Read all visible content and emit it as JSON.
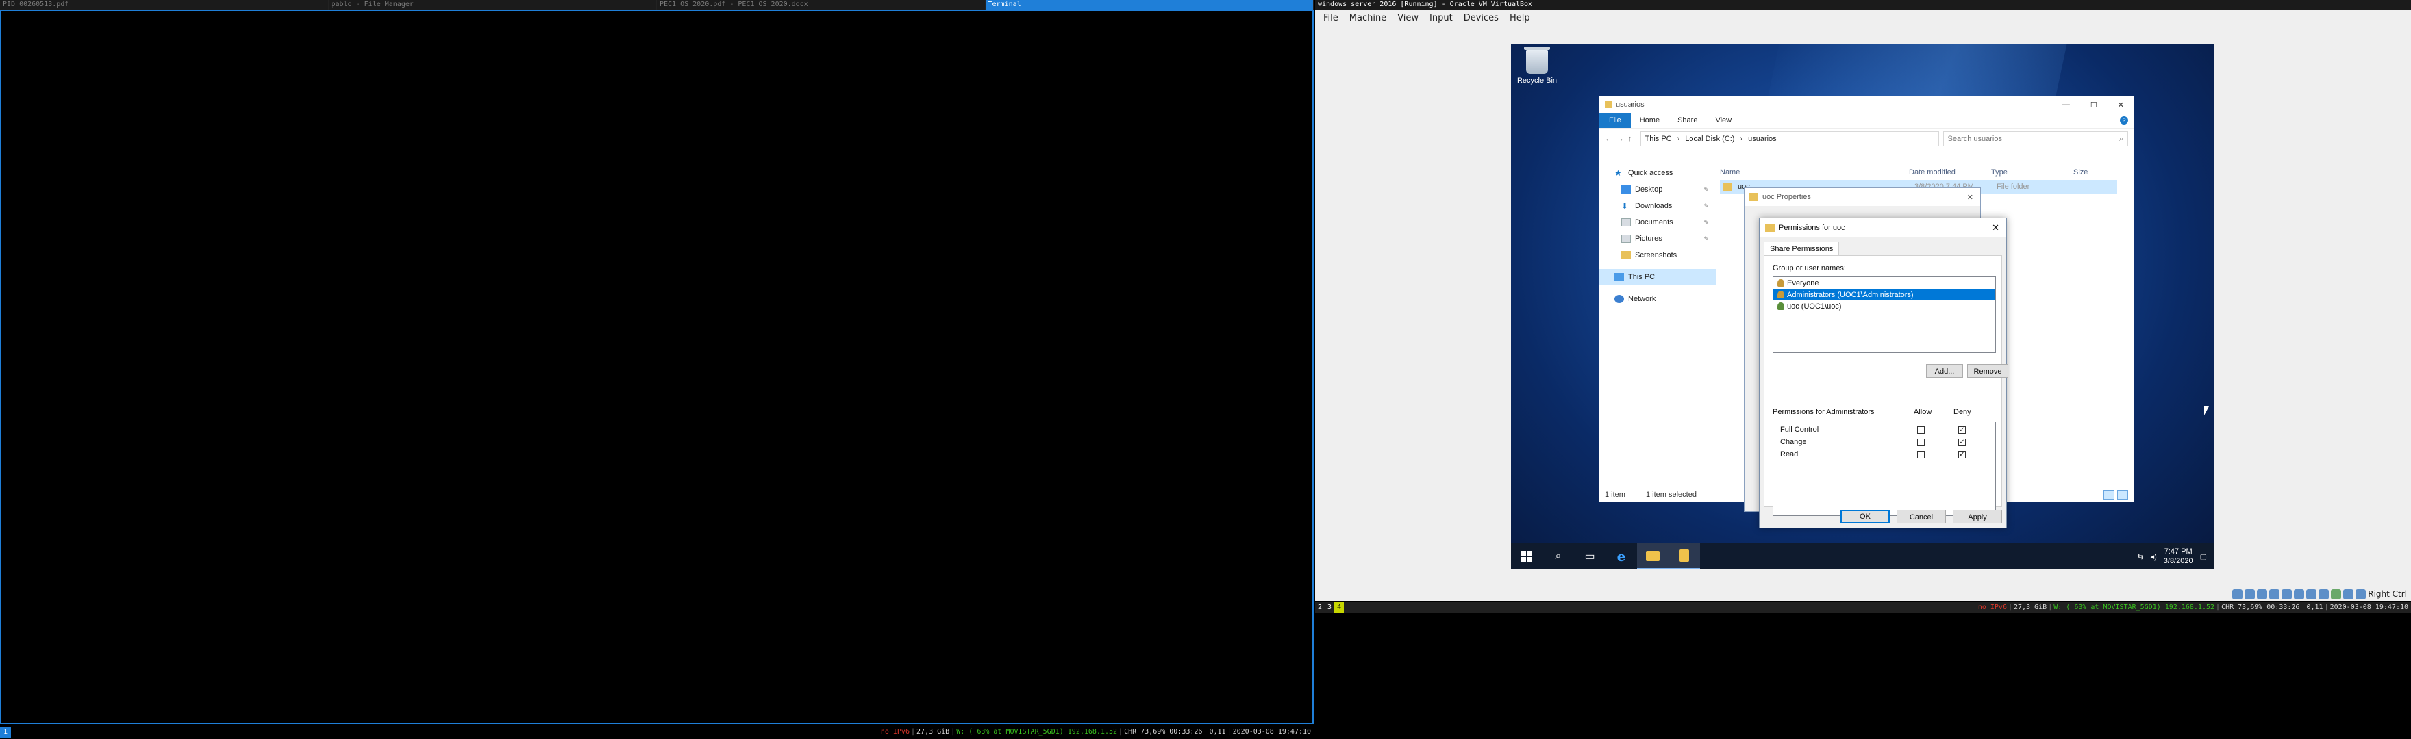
{
  "left_tabs": [
    "PID_00260513.pdf",
    "pablo - File Manager",
    "PEC1_OS_2020.pdf - PEC1_OS_2020.docx",
    "Terminal"
  ],
  "active_tab_index": 3,
  "status_bottom": {
    "workspace": "1",
    "disk_warn": "no IPv6",
    "disk": "27,3 GiB",
    "wifi": "W: ( 63% at MOVISTAR_5GD1) 192.168.1.52",
    "chr": "CHR 73,69% 00:33:26",
    "load": "0,11",
    "datetime": "2020-03-08 19:47:10"
  },
  "status_mid": {
    "ws_a": "2",
    "ws_b": "3",
    "ws_c": "4",
    "disk_warn": "no IPv6",
    "disk": "27,3 GiB",
    "wifi": "W: ( 63% at MOVISTAR_5GD1) 192.168.1.52",
    "chr": "CHR 73,69% 00:33:26",
    "load": "0,11",
    "datetime": "2020-03-08 19:47:10"
  },
  "vbox": {
    "title": "windows server 2016 [Running] - Oracle VM VirtualBox",
    "menu": [
      "File",
      "Machine",
      "View",
      "Input",
      "Devices",
      "Help"
    ],
    "host_key": "Right Ctrl"
  },
  "desktop": {
    "recycle_bin": "Recycle Bin"
  },
  "explorer": {
    "title": "usuarios",
    "tabs": [
      "File",
      "Home",
      "Share",
      "View"
    ],
    "path": [
      "This PC",
      "Local Disk (C:)",
      "usuarios"
    ],
    "search_placeholder": "Search usuarios",
    "nav": {
      "quick_access": "Quick access",
      "desktop": "Desktop",
      "downloads": "Downloads",
      "documents": "Documents",
      "pictures": "Pictures",
      "screenshots": "Screenshots",
      "this_pc": "This PC",
      "network": "Network"
    },
    "columns": [
      "Name",
      "Date modified",
      "Type",
      "Size"
    ],
    "row": {
      "name": "uoc",
      "date": "3/8/2020 7:44 PM",
      "type": "File folder"
    },
    "status_items": "1 item",
    "status_selected": "1 item selected"
  },
  "props": {
    "title": "uoc Properties"
  },
  "perm": {
    "title": "Permissions for uoc",
    "tab": "Share Permissions",
    "group_label": "Group or user names:",
    "users": [
      "Everyone",
      "Administrators (UOC1\\Administrators)",
      "uoc (UOC1\\uoc)"
    ],
    "selected_user": 1,
    "add": "Add...",
    "remove": "Remove",
    "perm_label": "Permissions for Administrators",
    "allow": "Allow",
    "deny": "Deny",
    "permissions": [
      {
        "name": "Full Control",
        "allow": false,
        "deny": true
      },
      {
        "name": "Change",
        "allow": false,
        "deny": true
      },
      {
        "name": "Read",
        "allow": false,
        "deny": true
      }
    ],
    "ok": "OK",
    "cancel": "Cancel",
    "apply": "Apply"
  },
  "taskbar": {
    "time": "7:47 PM",
    "date": "3/8/2020"
  },
  "colors": {
    "accent": "#1f7fd8",
    "win_blue": "#0078d7",
    "ws_yellow": "#c7d600"
  }
}
